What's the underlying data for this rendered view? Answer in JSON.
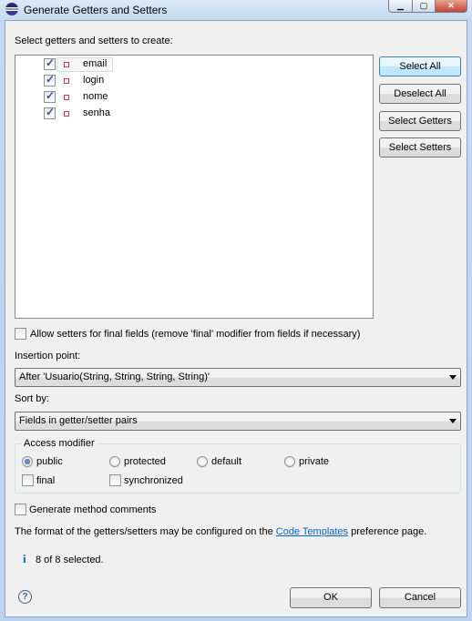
{
  "window": {
    "title": "Generate Getters and Setters"
  },
  "prompt": "Select getters and setters to create:",
  "fields": [
    {
      "name": "email",
      "checked": true
    },
    {
      "name": "login",
      "checked": true
    },
    {
      "name": "nome",
      "checked": true
    },
    {
      "name": "senha",
      "checked": true
    }
  ],
  "side_buttons": {
    "select_all": "Select All",
    "deselect_all": "Deselect All",
    "select_getters": "Select Getters",
    "select_setters": "Select Setters"
  },
  "allow_final": {
    "label": "Allow setters for final fields (remove 'final' modifier from fields if necessary)",
    "checked": false
  },
  "insertion": {
    "label": "Insertion point:",
    "value": "After 'Usuario(String, String, String, String)'"
  },
  "sort": {
    "label": "Sort by:",
    "value": "Fields in getter/setter pairs"
  },
  "access": {
    "label": "Access modifier",
    "options": [
      "public",
      "protected",
      "default",
      "private"
    ],
    "selected": "public",
    "final_label": "final",
    "final_checked": false,
    "sync_label": "synchronized",
    "sync_checked": false
  },
  "comments": {
    "label": "Generate method comments",
    "checked": false
  },
  "format": {
    "before": "The format of the getters/setters may be configured on the ",
    "link": "Code Templates",
    "after": " preference page."
  },
  "status": {
    "icon": "info-icon",
    "text": "8 of 8 selected."
  },
  "footer": {
    "ok": "OK",
    "cancel": "Cancel",
    "help_icon": "help-icon"
  }
}
